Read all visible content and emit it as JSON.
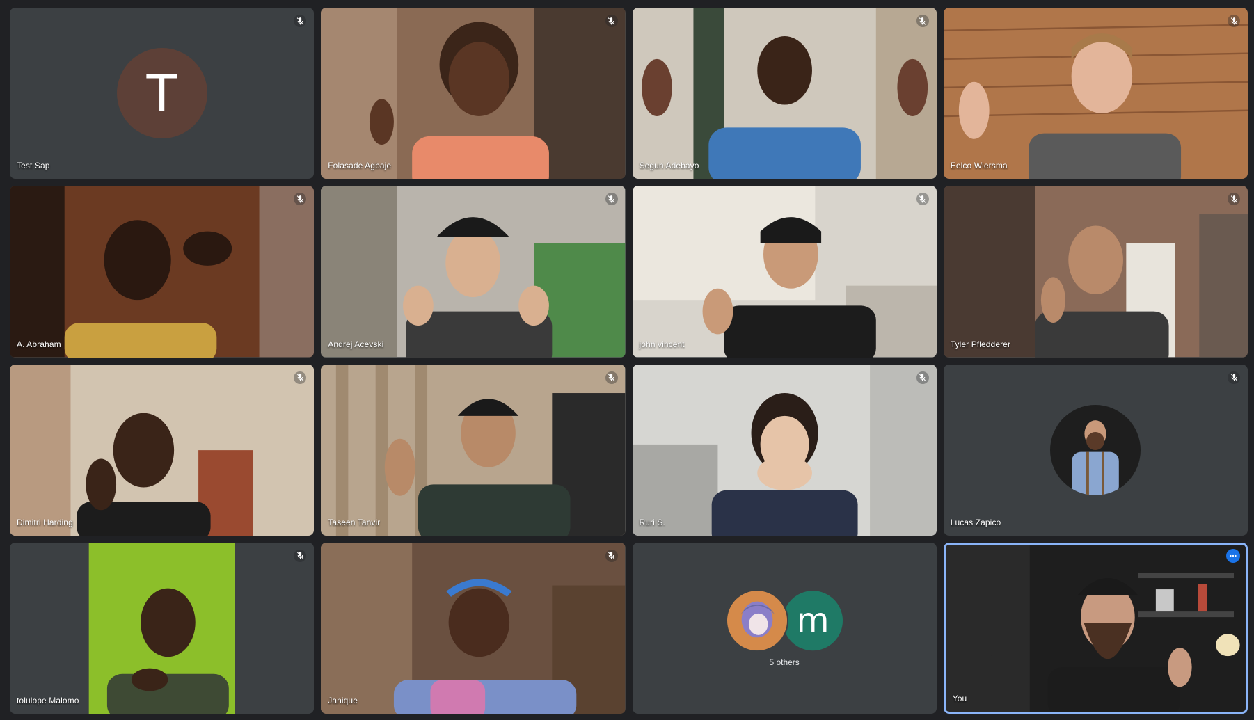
{
  "app": {
    "colors": {
      "background": "#202124",
      "tile": "#3c4043",
      "active_border": "#8ab4f8",
      "menu_button": "#1a73e8"
    }
  },
  "participants": [
    {
      "name": "Test Sap",
      "muted": true,
      "avatar_letter": "T",
      "avatar_color": "#5d4037"
    },
    {
      "name": "Folasade Agbaje",
      "muted": true
    },
    {
      "name": "Segun Adebayo",
      "muted": true
    },
    {
      "name": "Eelco Wiersma",
      "muted": true
    },
    {
      "name": "A. Abraham",
      "muted": true
    },
    {
      "name": "Andrej Acevski",
      "muted": true
    },
    {
      "name": "john vincent",
      "muted": true
    },
    {
      "name": "Tyler Pfledderer",
      "muted": true
    },
    {
      "name": "Dimitri Harding",
      "muted": true
    },
    {
      "name": "Taseen Tanvir",
      "muted": true
    },
    {
      "name": "Ruri S.",
      "muted": true
    },
    {
      "name": "Lucas Zapico",
      "muted": true
    },
    {
      "name": "tolulope Malomo",
      "muted": true
    },
    {
      "name": "Janique",
      "muted": true
    },
    {
      "group": true,
      "avatar_letter": "m",
      "avatar_color": "#1f7a66",
      "label": "5 others"
    },
    {
      "name": "You",
      "self": true
    }
  ],
  "icons": {
    "mute": "mic-off-icon",
    "more": "more-options-icon"
  }
}
